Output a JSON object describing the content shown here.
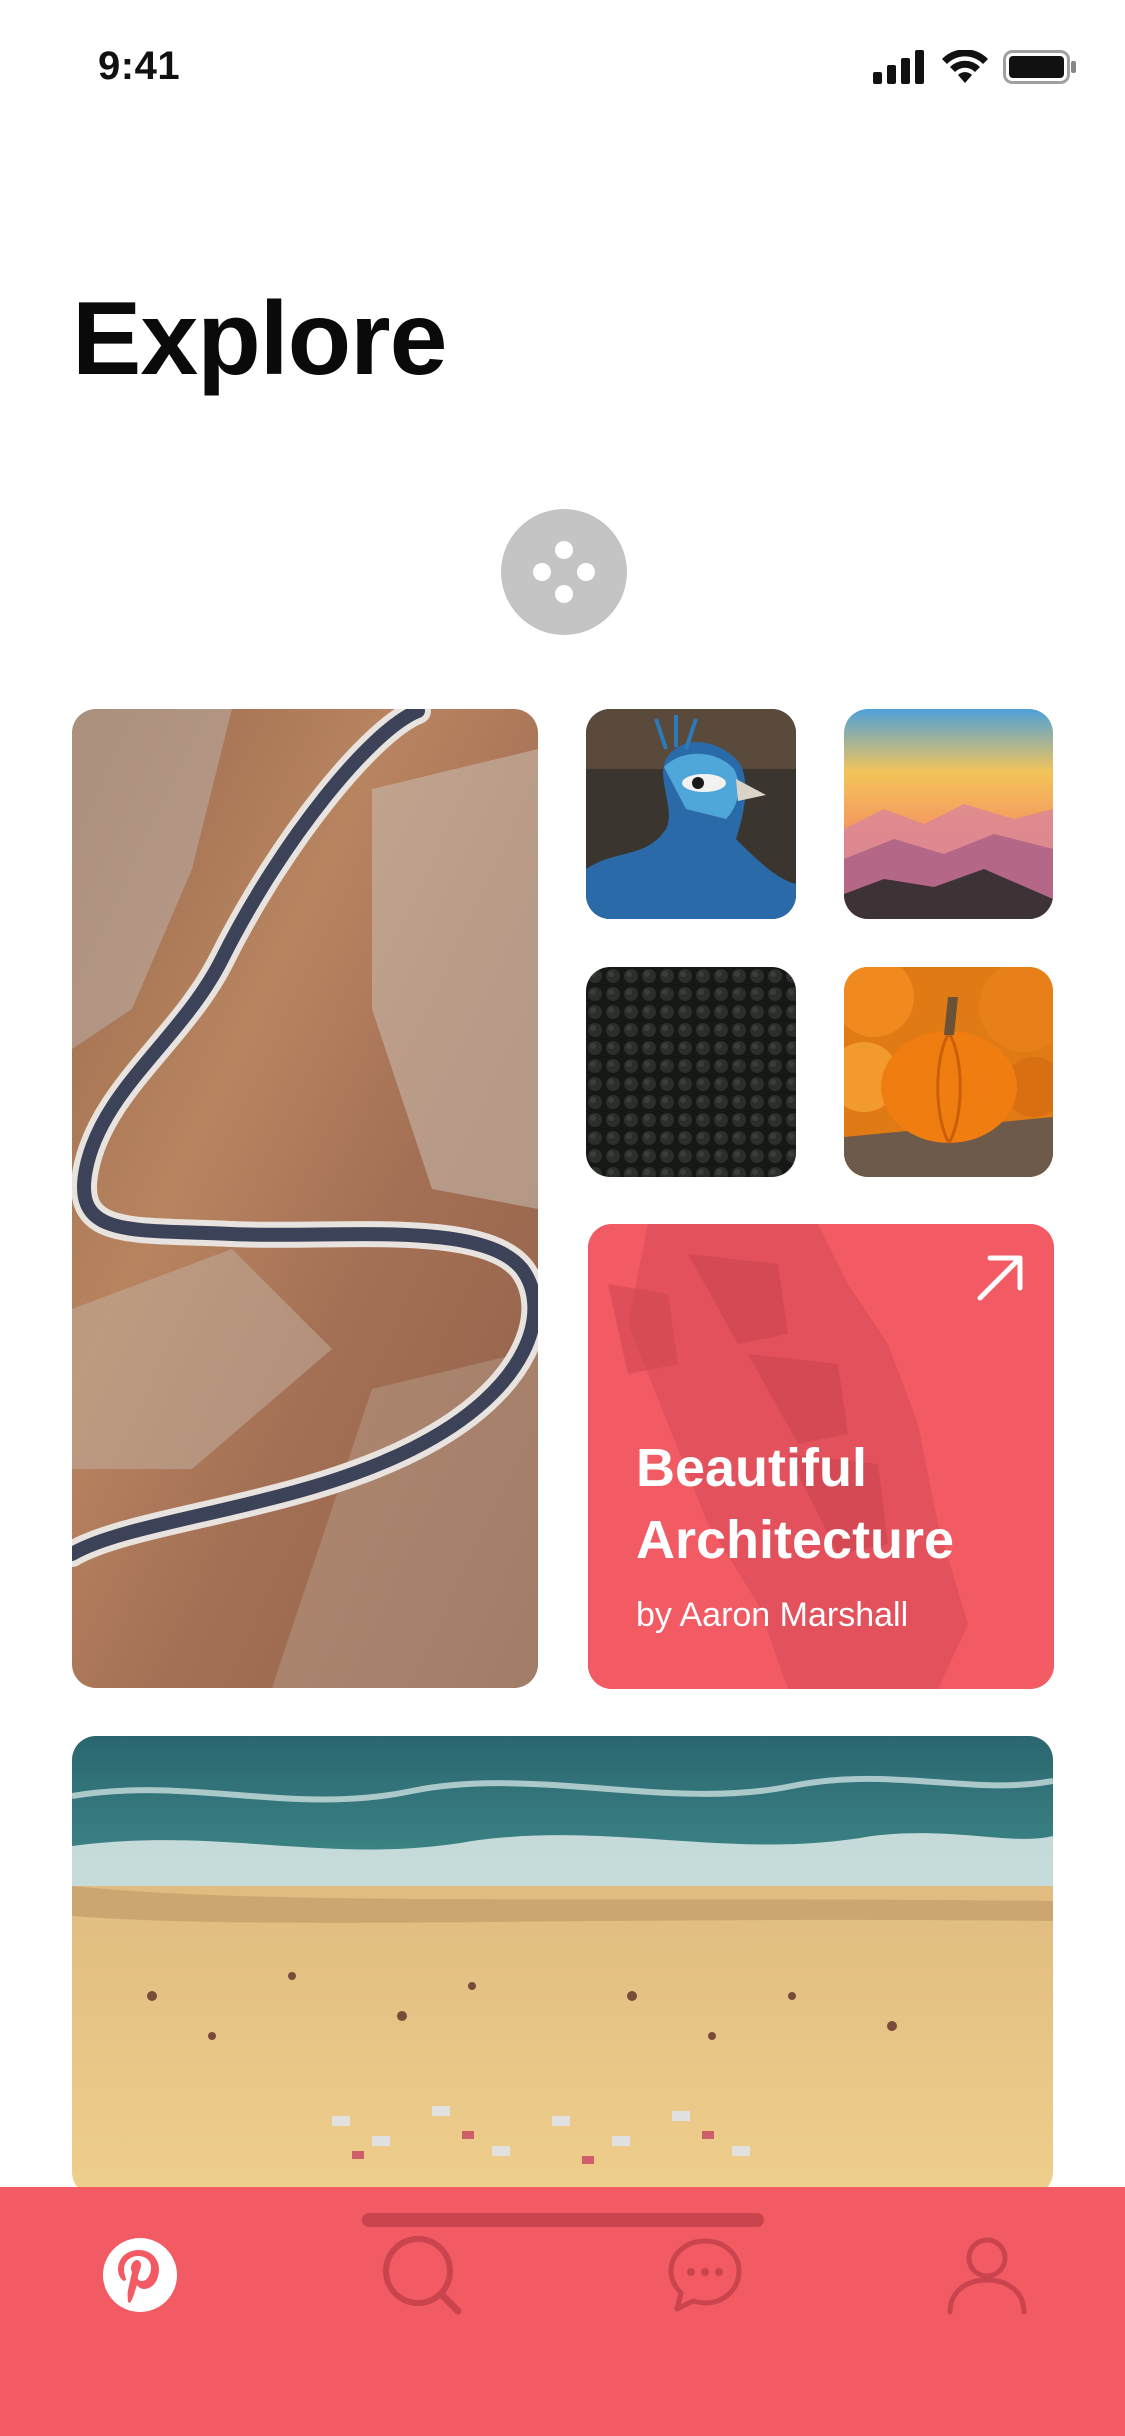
{
  "status_bar": {
    "time": "9:41",
    "icons": [
      "signal-icon",
      "wifi-icon",
      "battery-icon"
    ]
  },
  "page": {
    "title": "Explore"
  },
  "fab": {
    "icon": "shuffle-dots-icon"
  },
  "cards": [
    {
      "name": "winding-road-photo",
      "kind": "image"
    },
    {
      "name": "peacock-photo",
      "kind": "image"
    },
    {
      "name": "mountain-sunset-photo",
      "kind": "image"
    },
    {
      "name": "dark-texture-photo",
      "kind": "image"
    },
    {
      "name": "pumpkin-photo",
      "kind": "image"
    },
    {
      "name": "beach-aerial-photo",
      "kind": "image"
    }
  ],
  "feature_card": {
    "title_line1": "Beautiful",
    "title_line2": "Architecture",
    "author": "by Aaron Marshall",
    "icon": "arrow-up-right-icon"
  },
  "tab_bar": {
    "tabs": [
      {
        "icon": "pinterest-icon",
        "active": true
      },
      {
        "icon": "search-icon",
        "active": false
      },
      {
        "icon": "chat-icon",
        "active": false
      },
      {
        "icon": "profile-icon",
        "active": false
      }
    ]
  },
  "colors": {
    "accent": "#f25a64",
    "accent_dark": "#c9444d",
    "fab": "#c4c4c4"
  }
}
